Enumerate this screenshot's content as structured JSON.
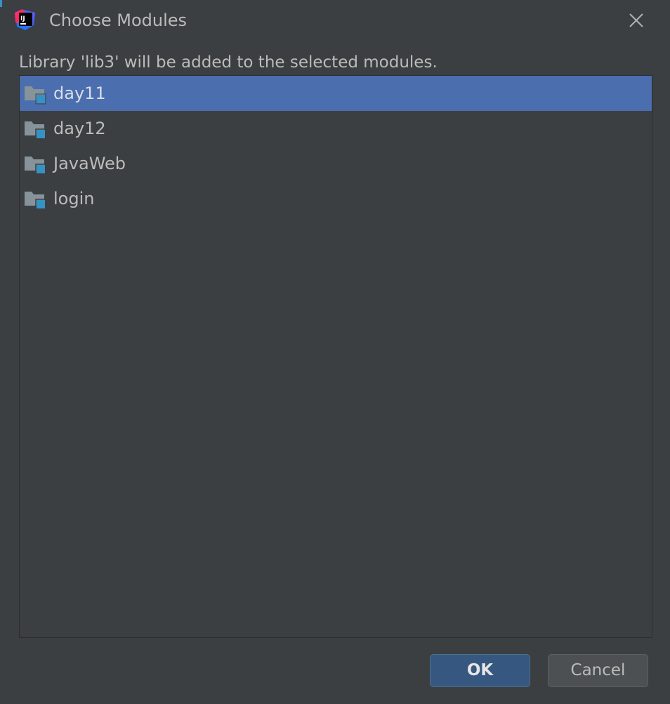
{
  "window": {
    "title": "Choose Modules",
    "app_icon": "intellij-idea-icon",
    "close_icon": "close-icon"
  },
  "message": "Library 'lib3' will be added to the selected modules.",
  "modules": [
    {
      "label": "day11",
      "icon": "module-folder-icon",
      "selected": true
    },
    {
      "label": "day12",
      "icon": "module-folder-icon",
      "selected": false
    },
    {
      "label": "JavaWeb",
      "icon": "module-folder-icon",
      "selected": false
    },
    {
      "label": "login",
      "icon": "module-folder-icon",
      "selected": false
    }
  ],
  "buttons": {
    "ok_label": "OK",
    "cancel_label": "Cancel"
  },
  "colors": {
    "background": "#3c3f41",
    "selection": "#4b6eaf",
    "ok_button": "#365880",
    "cancel_button": "#4c5052",
    "text": "#bbbbbb",
    "module_badge": "#3592c4"
  }
}
